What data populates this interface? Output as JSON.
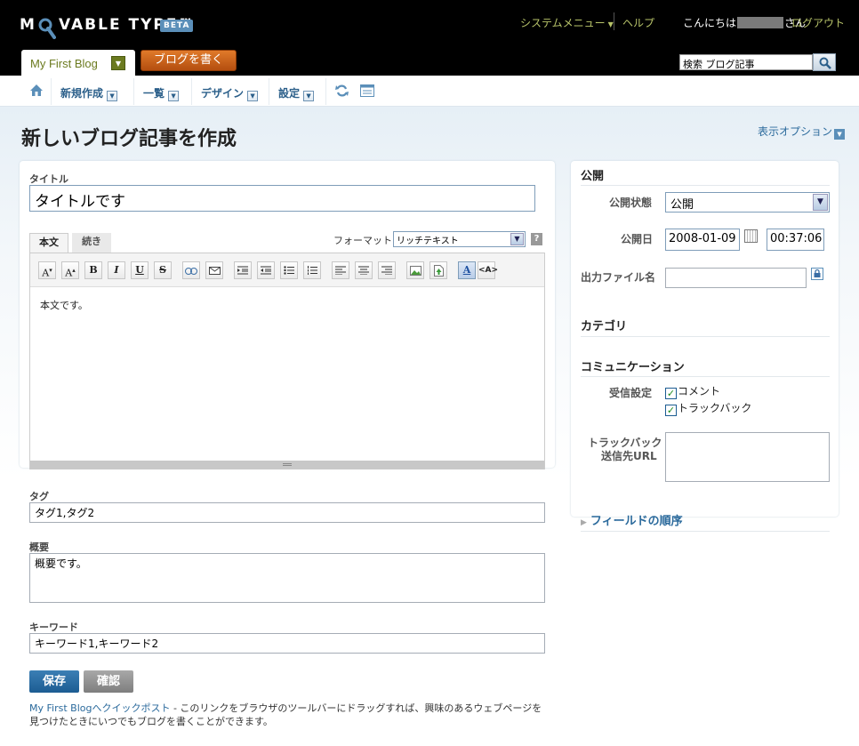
{
  "header": {
    "logo_left": "M",
    "logo_right": "VABLE TYPE™",
    "beta_badge": "BETA",
    "system_menu": "システムメニュー",
    "help": "ヘルプ",
    "greeting_prefix": "こんにちは",
    "greeting_suffix": "さん",
    "logout": "ログアウト",
    "blog_name": "My First Blog",
    "write_button": "ブログを書く",
    "search_value": "検索 ブログ記事"
  },
  "nav": {
    "new": "新規作成",
    "list": "一覧",
    "design": "デザイン",
    "settings": "設定"
  },
  "page": {
    "title": "新しいブログ記事を作成",
    "display_options": "表示オプション"
  },
  "editor": {
    "title_label": "タイトル",
    "title_value": "タイトルです",
    "tab_body": "本文",
    "tab_more": "続き",
    "format_label": "フォーマット:",
    "format_value": "リッチテキスト",
    "help_mark": "?",
    "body_text": "本文です。",
    "tags_label": "タグ",
    "tags_value": "タグ1,タグ2",
    "summary_label": "概要",
    "summary_value": "概要です。",
    "keywords_label": "キーワード",
    "keywords_value": "キーワード1,キーワード2",
    "save": "保存",
    "preview": "確認",
    "bookmarklet_link": "My First Blogへクイックポスト",
    "bookmarklet_text": " - このリンクをブラウザのツールバーにドラッグすれば、興味のあるウェブページを見つけたときにいつでもブログを書くことができます。"
  },
  "toolbar": {
    "font_smaller": "A",
    "font_larger": "A",
    "bold": "B",
    "italic": "I",
    "underline": "U",
    "strike": "S",
    "text_color": "A",
    "html_mode": "<A>"
  },
  "sidebar": {
    "publish_heading": "公開",
    "status_label": "公開状態",
    "status_value": "公開",
    "date_label": "公開日",
    "date_value": "2008-01-09",
    "time_value": "00:37:06",
    "basename_label": "出力ファイル名",
    "category_heading": "カテゴリ",
    "communication_heading": "コミュニケーション",
    "accept_label": "受信設定",
    "comments": "コメント",
    "trackbacks": "トラックバック",
    "trackback_url_label_1": "トラックバック",
    "trackback_url_label_2": "送信先URL",
    "field_order": "フィールドの順序"
  },
  "colors": {
    "accent_link": "#2b6a9c",
    "header_link": "#b8c46a",
    "write_button": "#c85e18",
    "save_button": "#1c5c92"
  }
}
